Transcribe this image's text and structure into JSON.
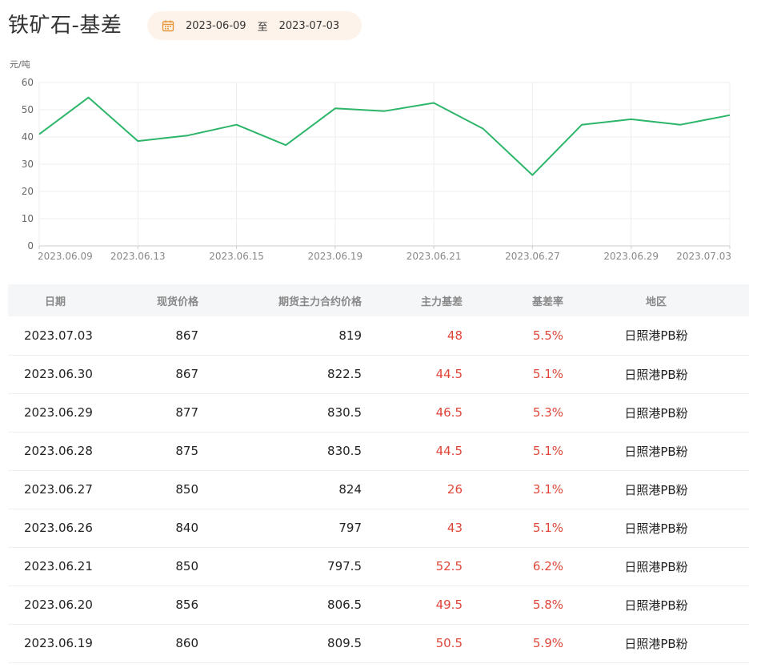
{
  "header": {
    "title": "铁矿石-基差",
    "date_start": "2023-06-09",
    "date_sep": "至",
    "date_end": "2023-07-03",
    "calendar_icon": "calendar-icon",
    "calendar_icon_color": "#e8963a",
    "date_pill_bg": "#fdf3ea"
  },
  "chart_data": {
    "type": "line",
    "ylabel": "元/吨",
    "ylim": [
      0,
      60
    ],
    "yticks": [
      0,
      10,
      20,
      30,
      40,
      50,
      60
    ],
    "x": [
      "2023.06.09",
      "2023.06.12",
      "2023.06.13",
      "2023.06.14",
      "2023.06.15",
      "2023.06.16",
      "2023.06.19",
      "2023.06.20",
      "2023.06.21",
      "2023.06.26",
      "2023.06.27",
      "2023.06.28",
      "2023.06.29",
      "2023.06.30",
      "2023.07.03"
    ],
    "xtick_labels": [
      "2023.06.09",
      "2023.06.13",
      "2023.06.15",
      "2023.06.19",
      "2023.06.21",
      "2023.06.27",
      "2023.06.29",
      "2023.07.03"
    ],
    "series": [
      {
        "values": [
          41,
          54.5,
          38.5,
          40.5,
          44.5,
          37,
          50.5,
          49.5,
          52.5,
          43,
          26,
          44.5,
          46.5,
          44.5,
          48
        ],
        "color": "#2db56a"
      }
    ],
    "grid": true
  },
  "table": {
    "columns": [
      "日期",
      "现货价格",
      "期货主力合约价格",
      "主力基差",
      "基差率",
      "地区"
    ],
    "rows": [
      [
        "2023.07.03",
        "867",
        "819",
        "48",
        "5.5%",
        "日照港PB粉"
      ],
      [
        "2023.06.30",
        "867",
        "822.5",
        "44.5",
        "5.1%",
        "日照港PB粉"
      ],
      [
        "2023.06.29",
        "877",
        "830.5",
        "46.5",
        "5.3%",
        "日照港PB粉"
      ],
      [
        "2023.06.28",
        "875",
        "830.5",
        "44.5",
        "5.1%",
        "日照港PB粉"
      ],
      [
        "2023.06.27",
        "850",
        "824",
        "26",
        "3.1%",
        "日照港PB粉"
      ],
      [
        "2023.06.26",
        "840",
        "797",
        "43",
        "5.1%",
        "日照港PB粉"
      ],
      [
        "2023.06.21",
        "850",
        "797.5",
        "52.5",
        "6.2%",
        "日照港PB粉"
      ],
      [
        "2023.06.20",
        "856",
        "806.5",
        "49.5",
        "5.8%",
        "日照港PB粉"
      ],
      [
        "2023.06.19",
        "860",
        "809.5",
        "50.5",
        "5.9%",
        "日照港PB粉"
      ]
    ],
    "accent_color": "#e0473a",
    "header_bg": "#f5f6f8"
  }
}
